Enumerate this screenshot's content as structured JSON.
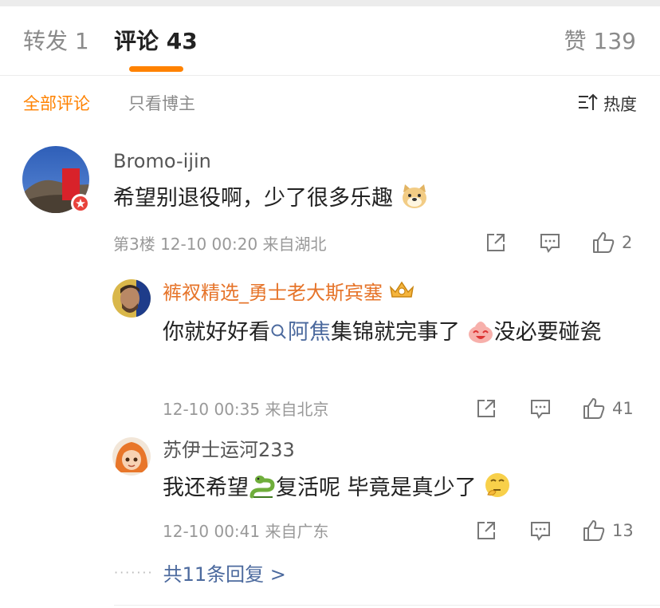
{
  "tabs": {
    "repost": "转发 1",
    "comments": "评论 43",
    "likes": "赞 139"
  },
  "filters": {
    "all": "全部评论",
    "author_only": "只看博主",
    "sort_label": "热度"
  },
  "comment": {
    "author": "Bromo-ijin",
    "text": "希望别退役啊，少了很多乐趣",
    "meta": "第3楼 12-10 00:20 来自湖北",
    "likes": "2"
  },
  "replies": [
    {
      "author": "裤衩精选_勇士老大斯宾塞",
      "text_part1": "你就好好看",
      "link_text": "阿焦",
      "text_part2": "集锦就完事了",
      "text_part3": "没必要碰瓷",
      "meta": "12-10 00:35 来自北京",
      "likes": "41"
    },
    {
      "author": "苏伊士运河233",
      "text_part1": "我还希望",
      "text_part2": "复活呢 毕竟是真少了",
      "meta": "12-10 00:41 来自广东",
      "likes": "13"
    }
  ],
  "more_replies": "共11条回复 >",
  "colors": {
    "accent": "#ff8200",
    "link": "#4c6a9e",
    "muted": "#999999"
  }
}
